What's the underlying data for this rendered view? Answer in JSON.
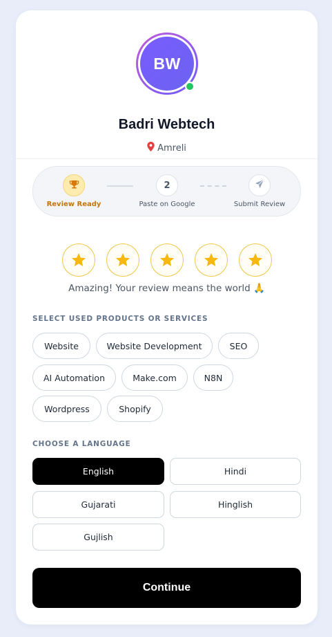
{
  "profile": {
    "initials": "BW",
    "name": "Badri Webtech",
    "location": "Amreli",
    "online_color": "#22c55e"
  },
  "steps": [
    {
      "label": "Review Ready",
      "icon": "trophy-icon",
      "state": "active"
    },
    {
      "label": "Paste on Google",
      "number": "2",
      "state": "pending"
    },
    {
      "label": "Submit Review",
      "icon": "send-icon",
      "state": "pending"
    }
  ],
  "rating": {
    "value": 5,
    "max": 5,
    "message": "Amazing! Your review means the world 🙏"
  },
  "products": {
    "heading": "SELECT USED PRODUCTS OR SERVICES",
    "options": [
      "Website",
      "Website Development",
      "SEO",
      "AI Automation",
      "Make.com",
      "N8N",
      "Wordpress",
      "Shopify"
    ]
  },
  "language": {
    "heading": "CHOOSE A LANGUAGE",
    "options": [
      "English",
      "Hindi",
      "Gujarati",
      "Hinglish",
      "Gujlish"
    ],
    "selected": "English"
  },
  "continue_label": "Continue",
  "colors": {
    "accent_gradient_start": "#c25bd6",
    "accent_gradient_end": "#6d5dfc",
    "star": "#f5b80b",
    "step_active": "#c2770b",
    "primary_button": "#000000"
  }
}
